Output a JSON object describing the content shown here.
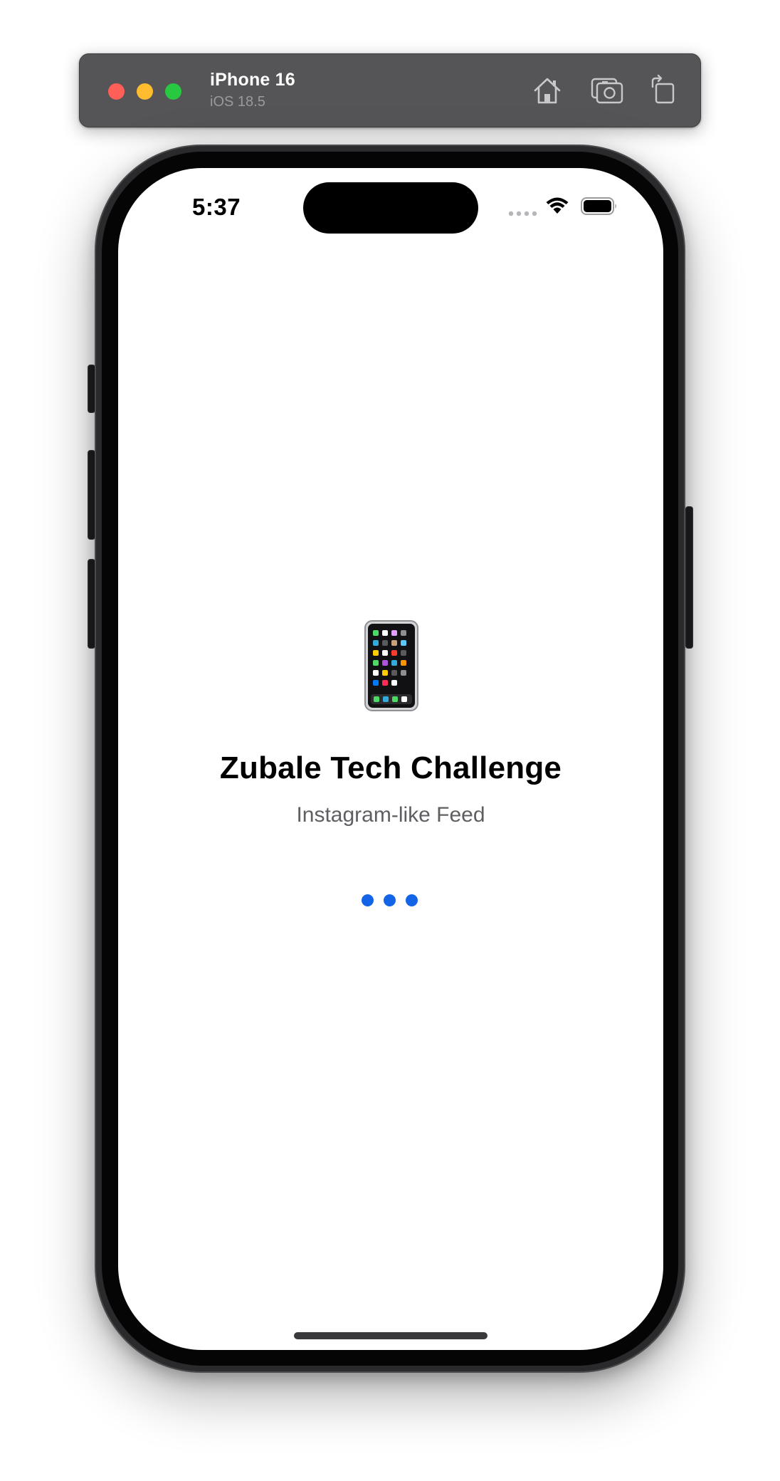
{
  "simulator": {
    "device_name": "iPhone 16",
    "os_version": "iOS 18.5",
    "buttons": [
      {
        "name": "home-icon"
      },
      {
        "name": "screenshot-icon"
      },
      {
        "name": "rotate-icon"
      }
    ]
  },
  "status_bar": {
    "time": "5:37",
    "icons": [
      "cellular-signal-icon",
      "wifi-icon",
      "battery-icon"
    ]
  },
  "splash": {
    "icon": "mobile-phone-icon",
    "title": "Zubale Tech Challenge",
    "subtitle": "Instagram-like Feed",
    "loading_indicator": "loading-dots",
    "accent_color": "#1464e8"
  }
}
